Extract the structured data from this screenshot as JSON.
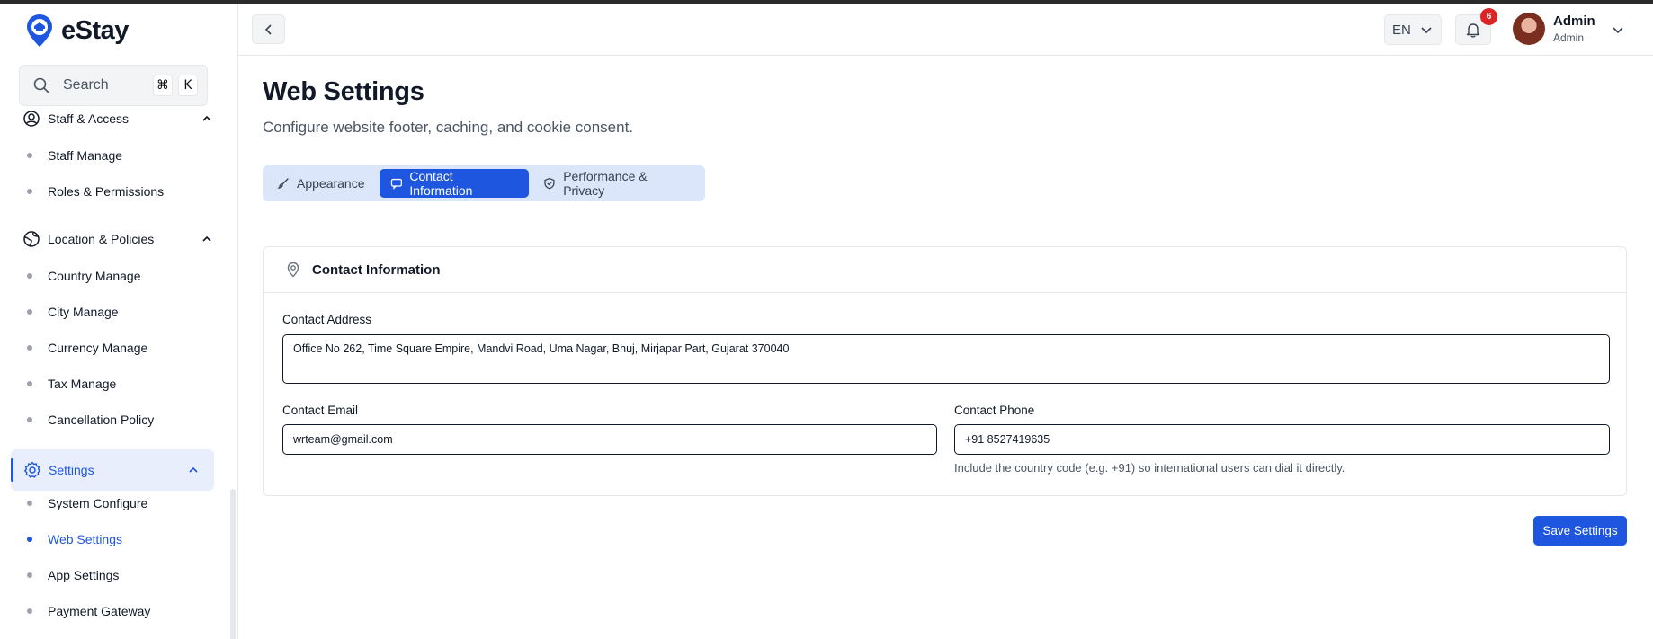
{
  "app": {
    "name": "eStay"
  },
  "search": {
    "label": "Search",
    "kbd1": "⌘",
    "kbd2": "K"
  },
  "sidebar": {
    "groups": [
      {
        "label": "Staff & Access",
        "items": [
          "Staff Manage",
          "Roles & Permissions"
        ]
      },
      {
        "label": "Location & Policies",
        "items": [
          "Country Manage",
          "City Manage",
          "Currency Manage",
          "Tax Manage",
          "Cancellation Policy"
        ]
      },
      {
        "label": "Settings",
        "items": [
          "System Configure",
          "Web Settings",
          "App Settings",
          "Payment Gateway"
        ]
      }
    ],
    "active_item": "Web Settings"
  },
  "header": {
    "language": "EN",
    "notification_count": "6",
    "user_name": "Admin",
    "user_role": "Admin"
  },
  "page": {
    "title": "Web Settings",
    "subtitle": "Configure website footer, caching, and cookie consent."
  },
  "tabs": [
    {
      "label": "Appearance",
      "icon": "brush-icon"
    },
    {
      "label": "Contact Information",
      "icon": "chat-icon",
      "active": true
    },
    {
      "label": "Performance & Privacy",
      "icon": "shield-icon"
    }
  ],
  "card": {
    "title": "Contact Information",
    "address_label": "Contact Address",
    "address_value": "Office No 262, Time Square Empire, Mandvi Road, Uma Nagar, Bhuj, Mirjapar Part, Gujarat 370040",
    "email_label": "Contact Email",
    "email_value": "wrteam@gmail.com",
    "phone_label": "Contact Phone",
    "phone_value": "+91 8527419635",
    "phone_help": "Include the country code (e.g. +91) so international users can dial it directly."
  },
  "actions": {
    "save_label": "Save Settings"
  },
  "colors": {
    "primary": "#1e56e0",
    "active_bg": "#e8eefc",
    "tabs_bg": "#dbe6fb",
    "badge": "#dc2626"
  }
}
